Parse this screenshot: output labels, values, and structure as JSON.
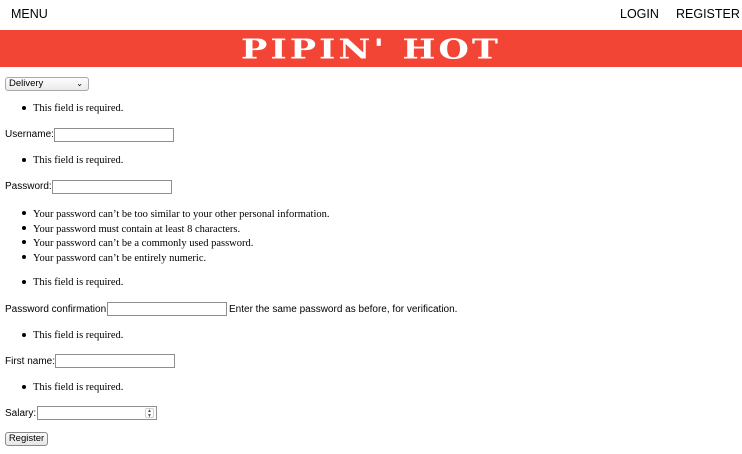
{
  "nav": {
    "menu": "MENU",
    "login": "LOGIN",
    "register": "REGISTER"
  },
  "banner": {
    "title": "PIPIN' HOT",
    "color": "#f24535"
  },
  "form": {
    "role_select": {
      "value": "Delivery",
      "options": [
        "Delivery"
      ]
    },
    "required_message": "This field is required.",
    "username_label": "Username:",
    "username_value": "",
    "password_label": "Password:",
    "password_value": "",
    "password_help": [
      "Your password can’t be too similar to your other personal information.",
      "Your password must contain at least 8 characters.",
      "Your password can’t be a commonly used password.",
      "Your password can’t be entirely numeric."
    ],
    "password_confirmation_label": "Password confirmation:",
    "password_confirmation_value": "",
    "password_confirmation_help": "Enter the same password as before, for verification.",
    "first_name_label": "First name:",
    "first_name_value": "",
    "salary_label": "Salary:",
    "salary_value": "",
    "submit_label": "Register"
  }
}
